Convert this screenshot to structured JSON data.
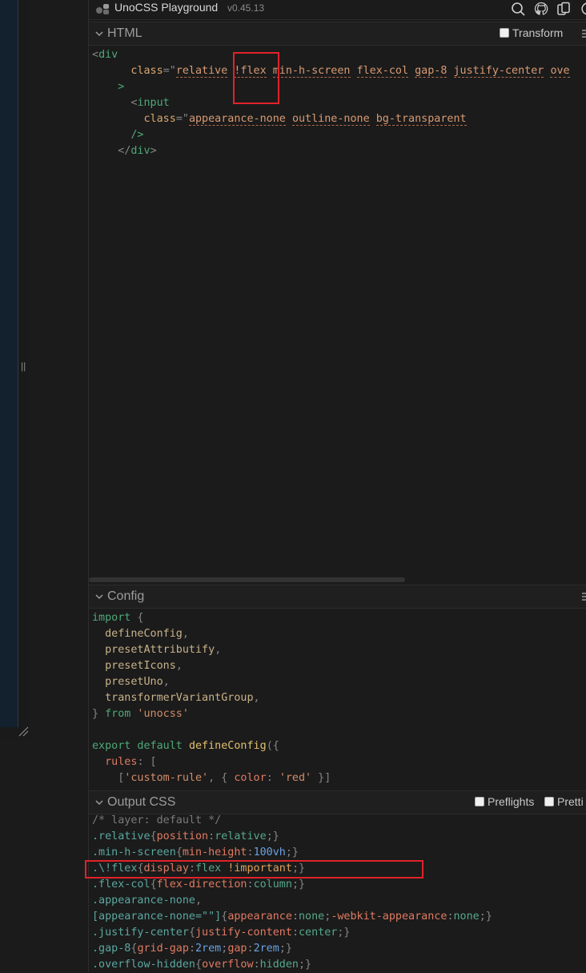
{
  "app": {
    "title": "UnoCSS Playground",
    "version": "v0.45.13"
  },
  "html_panel": {
    "title": "HTML",
    "transform_label": "Transform",
    "lines": [
      [
        [
          "c-punc",
          "<"
        ],
        [
          "c-tag",
          "div"
        ]
      ],
      [
        [
          "",
          "      "
        ],
        [
          "c-attr",
          "class"
        ],
        [
          "c-punc",
          "=\""
        ],
        [
          "c-cls",
          "relative"
        ],
        [
          "c-str",
          " "
        ],
        [
          "c-cls",
          "!flex"
        ],
        [
          "c-str",
          " "
        ],
        [
          "c-cls",
          "min-h-screen"
        ],
        [
          "c-str",
          " "
        ],
        [
          "c-cls",
          "flex-col"
        ],
        [
          "c-str",
          " "
        ],
        [
          "c-cls",
          "gap-8"
        ],
        [
          "c-str",
          " "
        ],
        [
          "c-cls",
          "justify-center"
        ],
        [
          "c-str",
          " "
        ],
        [
          "c-cls",
          "ove"
        ]
      ],
      [
        [
          "",
          "    "
        ],
        [
          "c-tag",
          ">"
        ]
      ],
      [
        [
          "",
          "      "
        ],
        [
          "c-punc",
          "<"
        ],
        [
          "c-tag",
          "input"
        ]
      ],
      [
        [
          "",
          "        "
        ],
        [
          "c-attr",
          "class"
        ],
        [
          "c-punc",
          "=\""
        ],
        [
          "c-cls",
          "appearance-none"
        ],
        [
          "c-str",
          " "
        ],
        [
          "c-cls",
          "outline-none"
        ],
        [
          "c-str",
          " "
        ],
        [
          "c-cls",
          "bg-transparent"
        ]
      ],
      [
        [
          "",
          "      "
        ],
        [
          "c-tag",
          "/>"
        ]
      ],
      [
        [
          "",
          "    "
        ],
        [
          "c-punc",
          "</"
        ],
        [
          "c-tag",
          "div"
        ],
        [
          "c-punc",
          ">"
        ]
      ]
    ]
  },
  "config_panel": {
    "title": "Config",
    "lines": [
      [
        [
          "c-kw",
          "import"
        ],
        [
          "c-punc",
          " {"
        ]
      ],
      [
        [
          "c-id",
          "  defineConfig"
        ],
        [
          "c-punc",
          ","
        ]
      ],
      [
        [
          "c-id",
          "  presetAttributify"
        ],
        [
          "c-punc",
          ","
        ]
      ],
      [
        [
          "c-id",
          "  presetIcons"
        ],
        [
          "c-punc",
          ","
        ]
      ],
      [
        [
          "c-id",
          "  presetUno"
        ],
        [
          "c-punc",
          ","
        ]
      ],
      [
        [
          "c-id",
          "  transformerVariantGroup"
        ],
        [
          "c-punc",
          ","
        ]
      ],
      [
        [
          "c-punc",
          "} "
        ],
        [
          "c-kw",
          "from"
        ],
        [
          "c-str",
          " 'unocss'"
        ]
      ],
      [
        [
          "",
          ""
        ]
      ],
      [
        [
          "c-kw",
          "export default"
        ],
        [
          "c-punc",
          " "
        ],
        [
          "c-fn",
          "defineConfig"
        ],
        [
          "c-punc",
          "({"
        ]
      ],
      [
        [
          "c-prop",
          "  rules"
        ],
        [
          "c-punc",
          ": ["
        ]
      ],
      [
        [
          "c-punc",
          "    ["
        ],
        [
          "c-str",
          "'custom-rule'"
        ],
        [
          "c-punc",
          ", { "
        ],
        [
          "c-prop",
          "color"
        ],
        [
          "c-punc",
          ": "
        ],
        [
          "c-str",
          "'red'"
        ],
        [
          "c-punc",
          " }]"
        ]
      ]
    ]
  },
  "output_panel": {
    "title": "Output CSS",
    "preflights_label": "Preflights",
    "prettify_label": "Pretti",
    "lines": [
      [
        [
          "c-comment",
          "/* layer: default */"
        ]
      ],
      [
        [
          "c-sel",
          ".relative"
        ],
        [
          "c-punc",
          "{"
        ],
        [
          "c-prop",
          "position"
        ],
        [
          "c-punc",
          ":"
        ],
        [
          "c-val",
          "relative"
        ],
        [
          "c-punc",
          ";}"
        ]
      ],
      [
        [
          "c-sel",
          ".min-h-screen"
        ],
        [
          "c-punc",
          "{"
        ],
        [
          "c-prop",
          "min-height"
        ],
        [
          "c-punc",
          ":"
        ],
        [
          "c-num",
          "100vh"
        ],
        [
          "c-punc",
          ";}"
        ]
      ],
      [
        [
          "c-sel",
          ".\\!flex"
        ],
        [
          "c-punc",
          "{"
        ],
        [
          "c-prop",
          "display"
        ],
        [
          "c-punc",
          ":"
        ],
        [
          "c-val",
          "flex "
        ],
        [
          "c-imp",
          "!important"
        ],
        [
          "c-punc",
          ";}"
        ]
      ],
      [
        [
          "c-sel",
          ".flex-col"
        ],
        [
          "c-punc",
          "{"
        ],
        [
          "c-prop",
          "flex-direction"
        ],
        [
          "c-punc",
          ":"
        ],
        [
          "c-val",
          "column"
        ],
        [
          "c-punc",
          ";}"
        ]
      ],
      [
        [
          "c-sel",
          ".appearance-none"
        ],
        [
          "c-punc",
          ","
        ]
      ],
      [
        [
          "c-sel",
          "[appearance-none=\"\"]"
        ],
        [
          "c-punc",
          "{"
        ],
        [
          "c-prop",
          "appearance"
        ],
        [
          "c-punc",
          ":"
        ],
        [
          "c-val",
          "none"
        ],
        [
          "c-punc",
          ";"
        ],
        [
          "c-prop",
          "-webkit-appearance"
        ],
        [
          "c-punc",
          ":"
        ],
        [
          "c-val",
          "none"
        ],
        [
          "c-punc",
          ";}"
        ]
      ],
      [
        [
          "c-sel",
          ".justify-center"
        ],
        [
          "c-punc",
          "{"
        ],
        [
          "c-prop",
          "justify-content"
        ],
        [
          "c-punc",
          ":"
        ],
        [
          "c-val",
          "center"
        ],
        [
          "c-punc",
          ";}"
        ]
      ],
      [
        [
          "c-sel",
          ".gap-8"
        ],
        [
          "c-punc",
          "{"
        ],
        [
          "c-prop",
          "grid-gap"
        ],
        [
          "c-punc",
          ":"
        ],
        [
          "c-num",
          "2rem"
        ],
        [
          "c-punc",
          ";"
        ],
        [
          "c-prop",
          "gap"
        ],
        [
          "c-punc",
          ":"
        ],
        [
          "c-num",
          "2rem"
        ],
        [
          "c-punc",
          ";}"
        ]
      ],
      [
        [
          "c-sel",
          ".overflow-hidden"
        ],
        [
          "c-punc",
          "{"
        ],
        [
          "c-prop",
          "overflow"
        ],
        [
          "c-punc",
          ":"
        ],
        [
          "c-val",
          "hidden"
        ],
        [
          "c-punc",
          ";}"
        ]
      ]
    ]
  },
  "icons": [
    "logo-icon",
    "search-icon",
    "github-icon",
    "share-icon",
    "theme-icon",
    "chevron-down-icon",
    "menu-icon",
    "resize-grip-icon"
  ]
}
